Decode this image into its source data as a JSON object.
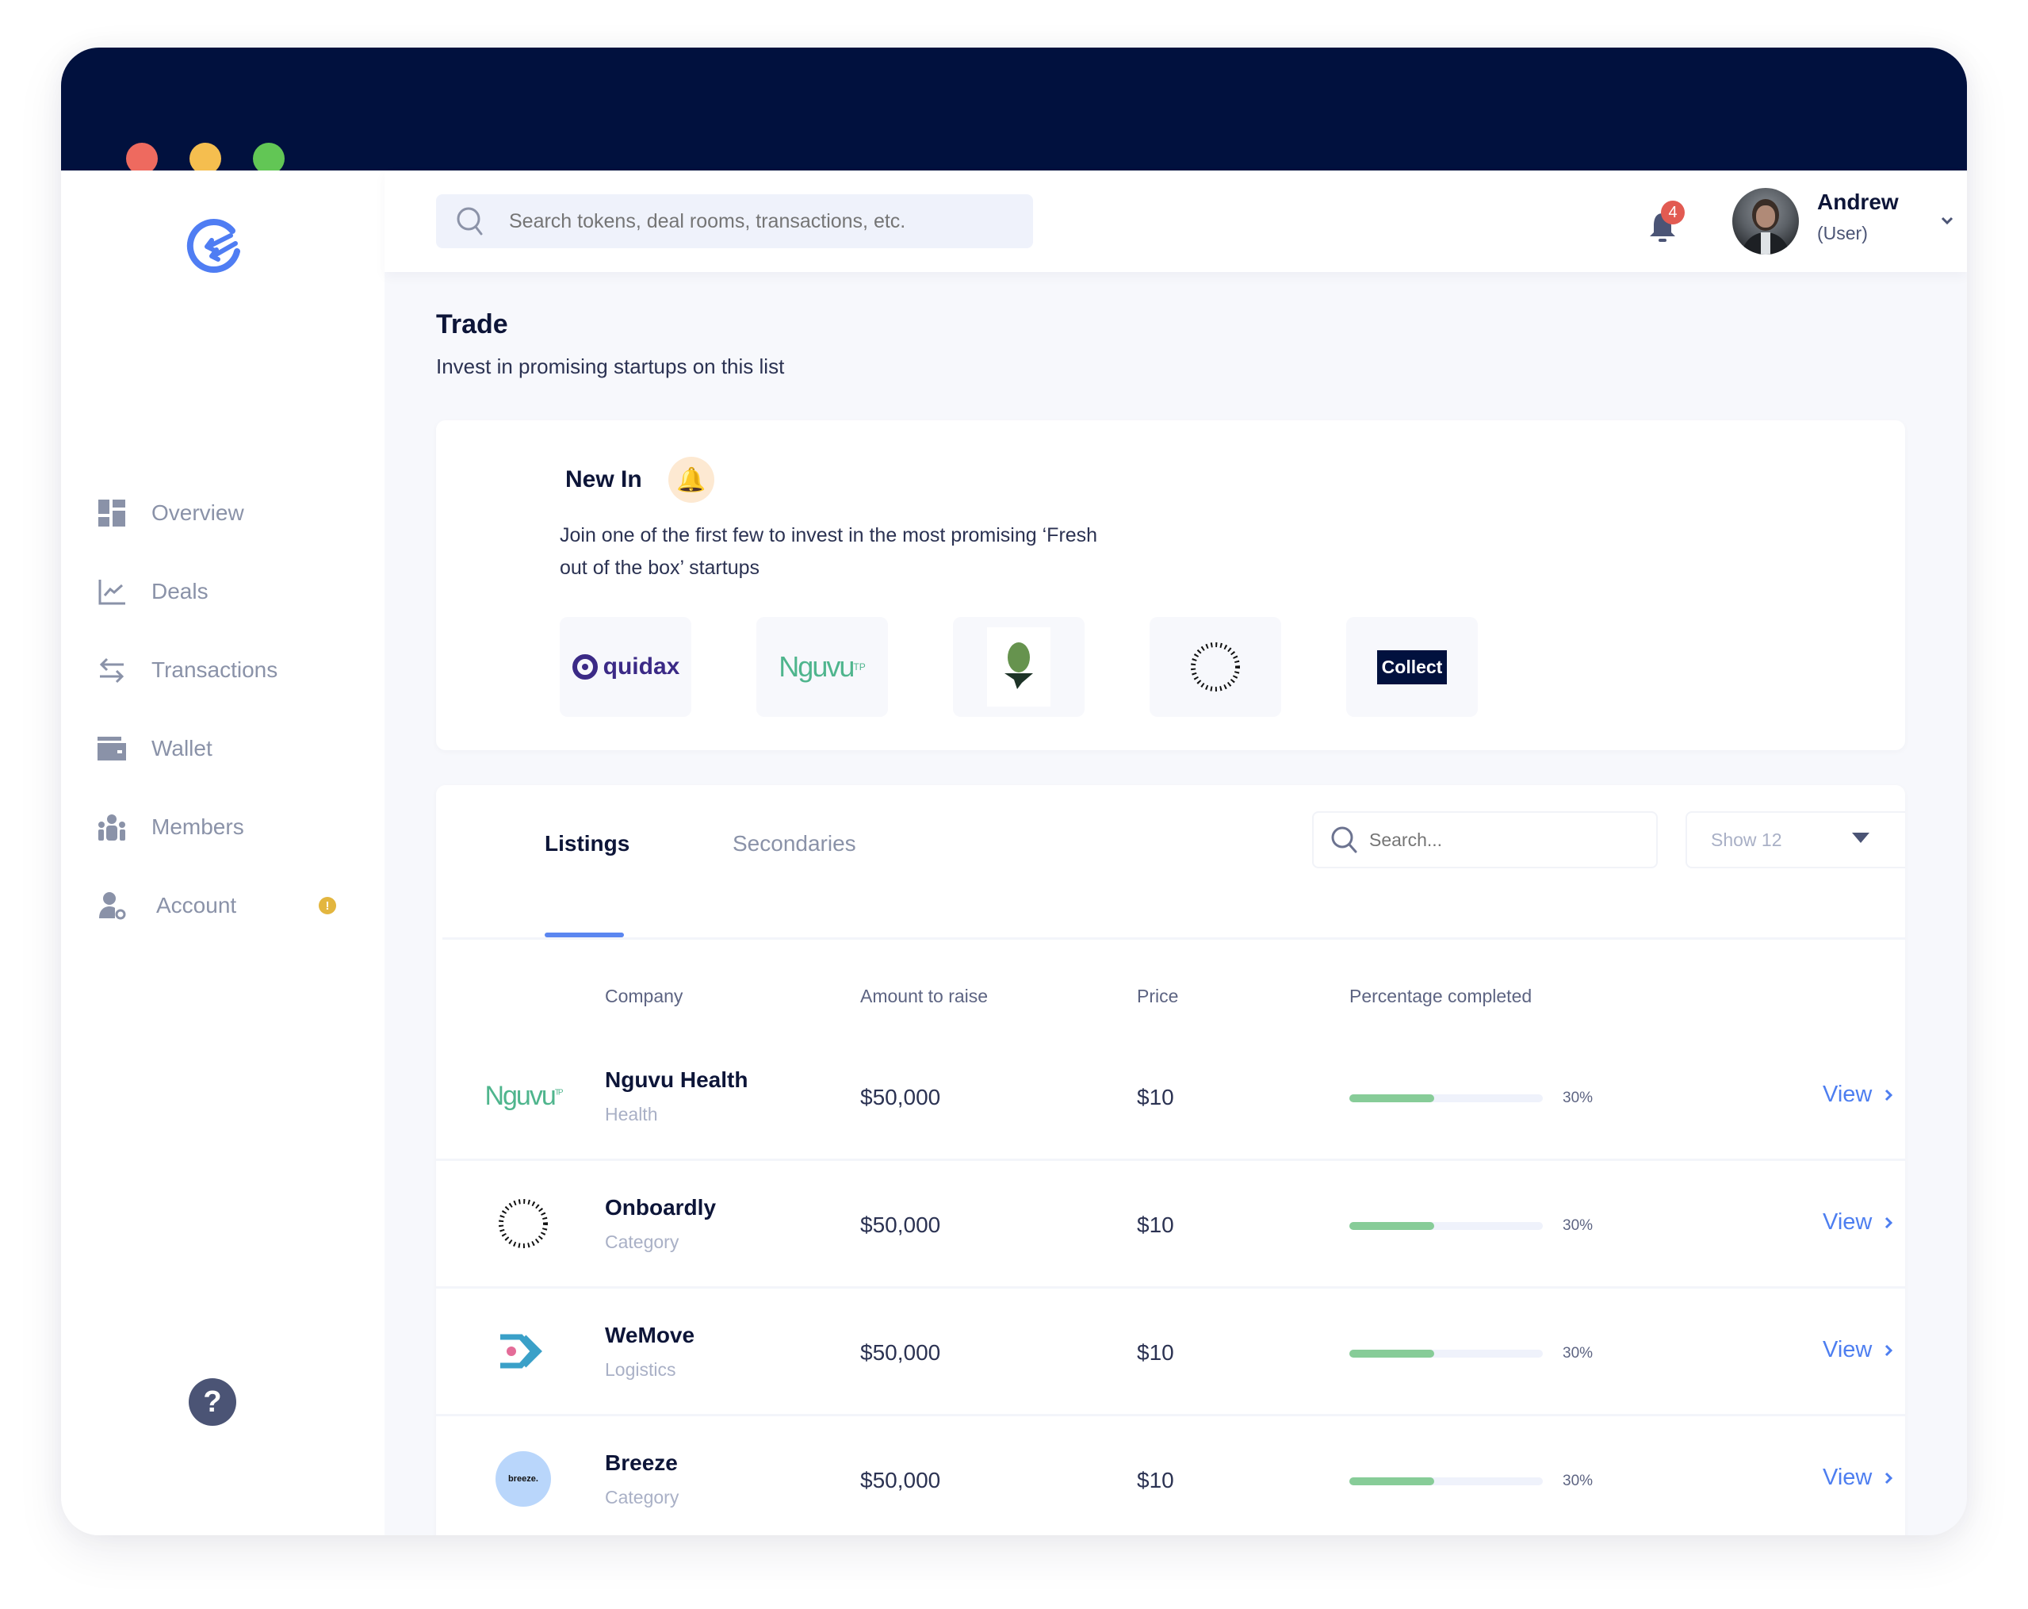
{
  "window": {
    "traffic_lights": [
      {
        "name": "close",
        "color": "#ee6a5f"
      },
      {
        "name": "minimize",
        "color": "#f5be4f"
      },
      {
        "name": "maximize",
        "color": "#62c655"
      }
    ]
  },
  "brand": {
    "logo_icon": "brand-logo-icon",
    "color": "#4f7df3"
  },
  "sidebar": {
    "items": [
      {
        "label": "Overview",
        "icon": "dashboard-grid-icon"
      },
      {
        "label": "Deals",
        "icon": "line-chart-icon"
      },
      {
        "label": "Transactions",
        "icon": "swap-arrows-icon"
      },
      {
        "label": "Wallet",
        "icon": "wallet-icon"
      },
      {
        "label": "Members",
        "icon": "members-group-icon"
      },
      {
        "label": "Account",
        "icon": "user-settings-icon",
        "badge": "!"
      }
    ],
    "help_icon": "?"
  },
  "topbar": {
    "search_placeholder": "Search tokens, deal rooms, transactions, etc.",
    "notification_count": "4",
    "user": {
      "name": "Andrew",
      "role": "(User)"
    }
  },
  "page": {
    "title": "Trade",
    "subtitle": "Invest in promising startups on this list"
  },
  "new_in": {
    "title": "New In",
    "emoji": "🔔",
    "description_line1": "Join one of the first few to invest in the most promising ‘Fresh",
    "description_line2": "out of the box’ startups",
    "logos": [
      {
        "name": "quidax",
        "label": "quidax"
      },
      {
        "name": "nguvu",
        "label": "Nguvu"
      },
      {
        "name": "green-pin",
        "label": ""
      },
      {
        "name": "onboardly",
        "label": ""
      },
      {
        "name": "collect",
        "label": "Collect"
      }
    ]
  },
  "listings": {
    "tabs": [
      {
        "label": "Listings",
        "active": true
      },
      {
        "label": "Secondaries",
        "active": false
      }
    ],
    "search_placeholder": "Search...",
    "show_select": "Show 12",
    "columns": [
      "Company",
      "Amount to raise",
      "Price",
      "Percentage completed"
    ],
    "rows": [
      {
        "logo": "nguvu",
        "logo_text": "Nguvu",
        "company": "Nguvu Health",
        "category": "Health",
        "amount": "$50,000",
        "price": "$10",
        "percent_label": "30%",
        "bar_fill": 0.44,
        "action": "View"
      },
      {
        "logo": "onboardly",
        "logo_text": "",
        "company": "Onboardly",
        "category": "Category",
        "amount": "$50,000",
        "price": "$10",
        "percent_label": "30%",
        "bar_fill": 0.44,
        "action": "View"
      },
      {
        "logo": "wemove",
        "logo_text": "",
        "company": "WeMove",
        "category": "Logistics",
        "amount": "$50,000",
        "price": "$10",
        "percent_label": "30%",
        "bar_fill": 0.44,
        "action": "View"
      },
      {
        "logo": "breeze",
        "logo_text": "breeze.",
        "company": "Breeze",
        "category": "Category",
        "amount": "$50,000",
        "price": "$10",
        "percent_label": "30%",
        "bar_fill": 0.44,
        "action": "View"
      }
    ]
  }
}
